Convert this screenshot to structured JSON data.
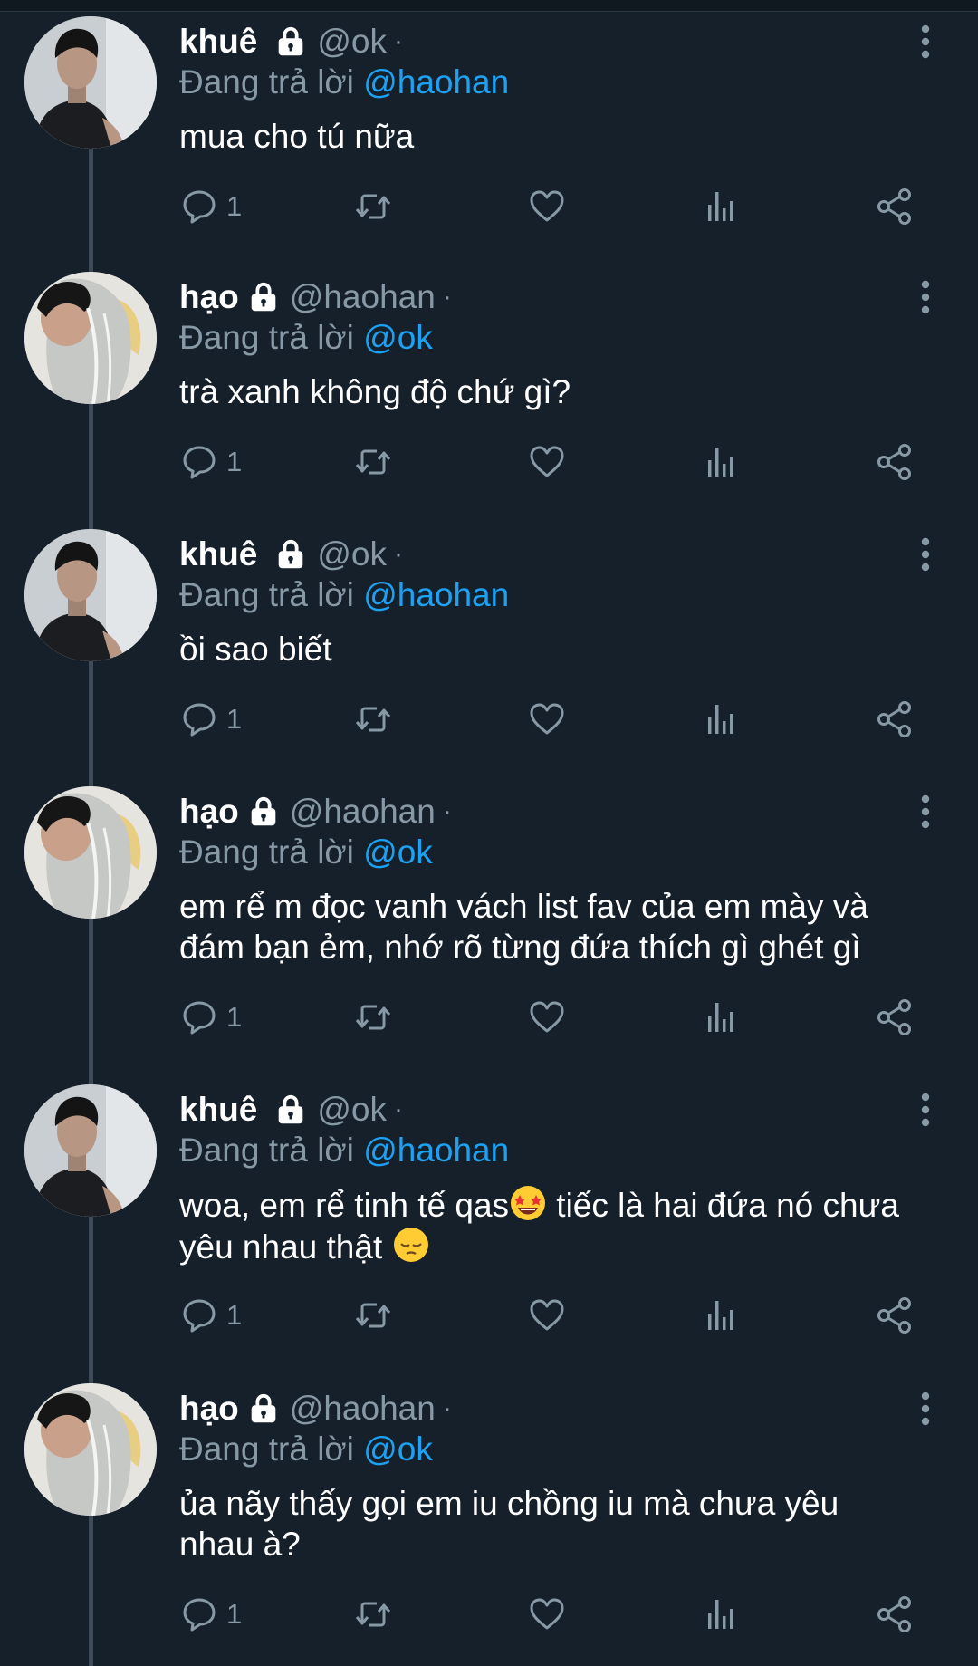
{
  "colors": {
    "background": "#15202b",
    "muted": "#8899a6",
    "mention": "#1da1f2",
    "thread_line": "#3e4a57"
  },
  "icons": {
    "reply": "reply-icon",
    "retweet": "retweet-icon",
    "like": "heart-icon",
    "analytics": "analytics-icon",
    "share": "share-icon",
    "more": "more-icon",
    "lock": "lock-icon"
  },
  "tweets": [
    {
      "name": "khuê",
      "handle": "@ok",
      "dot": "·",
      "reply_prefix": "Đang trả lời",
      "reply_to": "@haohan",
      "lines": [
        "mua cho tú nữa"
      ],
      "reply_count": "1"
    },
    {
      "name": "hạo",
      "handle": "@haohan",
      "dot": "·",
      "reply_prefix": "Đang trả lời",
      "reply_to": "@ok",
      "lines": [
        "trà xanh không độ chứ gì?"
      ],
      "reply_count": "1"
    },
    {
      "name": "khuê",
      "handle": "@ok",
      "dot": "·",
      "reply_prefix": "Đang trả lời",
      "reply_to": "@haohan",
      "lines": [
        "ồi sao biết"
      ],
      "reply_count": "1"
    },
    {
      "name": "hạo",
      "handle": "@haohan",
      "dot": "·",
      "reply_prefix": "Đang trả lời",
      "reply_to": "@ok",
      "lines": [
        "em rể m đọc vanh vách list fav của em mày và",
        "đám bạn ẻm, nhớ rõ từng đứa thích gì ghét gì"
      ],
      "reply_count": "1"
    },
    {
      "name": "khuê",
      "handle": "@ok",
      "dot": "·",
      "reply_prefix": "Đang trả lời",
      "reply_to": "@haohan",
      "lines": [
        "woa, em rể tinh tế qas",
        " tiếc là hai đứa nó chưa",
        "yêu nhau thật "
      ],
      "reply_count": "1",
      "emojis": [
        "star-struck-emoji",
        "pensive-emoji"
      ]
    },
    {
      "name": "hạo",
      "handle": "@haohan",
      "dot": "·",
      "reply_prefix": "Đang trả lời",
      "reply_to": "@ok",
      "lines": [
        "ủa nãy thấy gọi em iu chồng iu mà chưa yêu",
        "nhau à?"
      ],
      "reply_count": "1"
    }
  ]
}
